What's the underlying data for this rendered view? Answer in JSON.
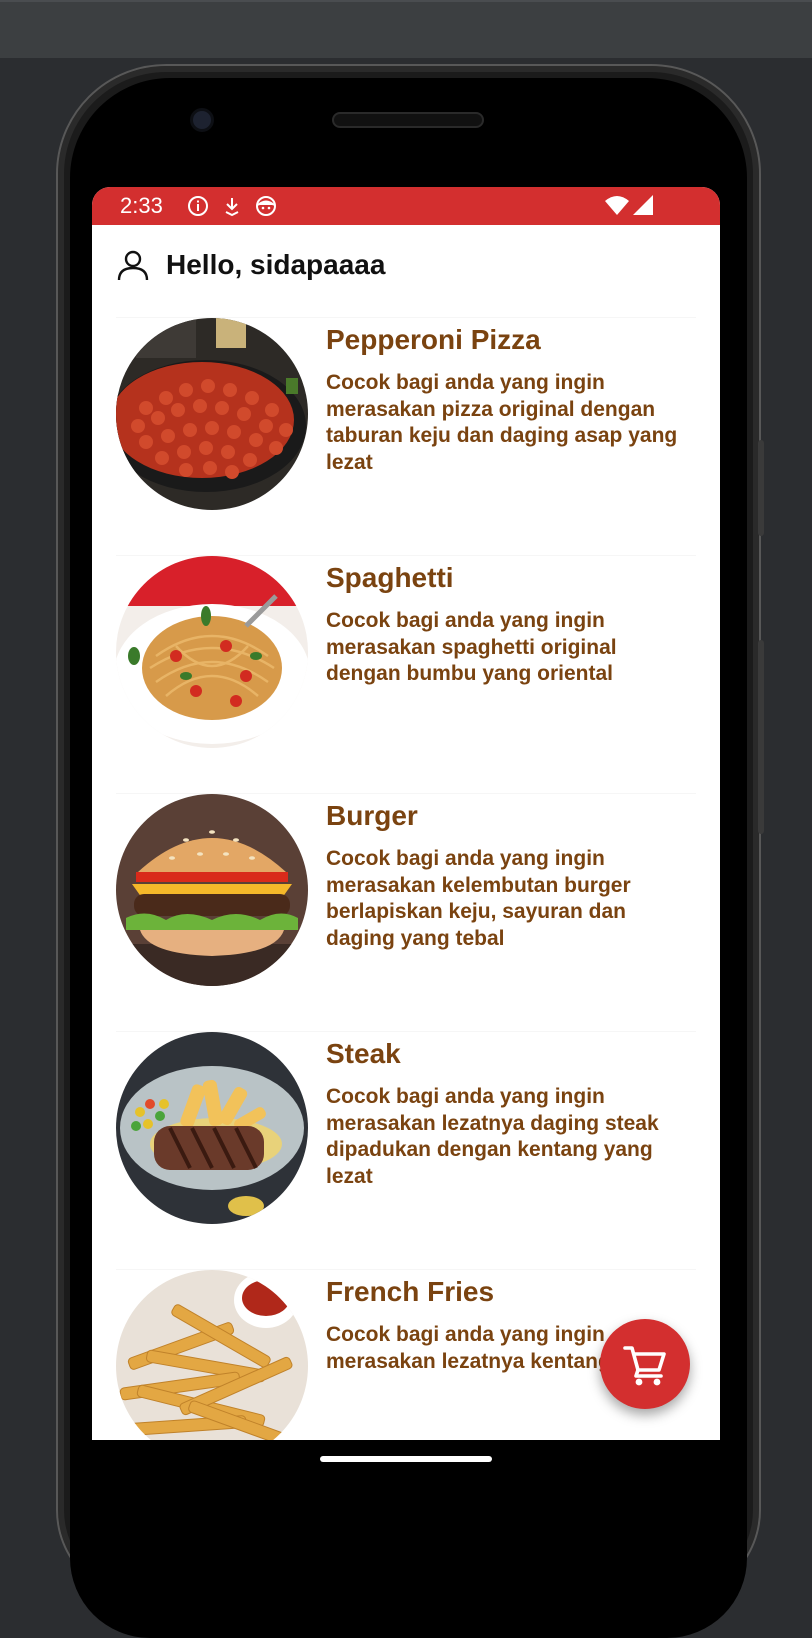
{
  "status_bar": {
    "time": "2:33",
    "icons": [
      "info-icon",
      "download-icon",
      "face-icon",
      "wifi-icon",
      "signal-icon"
    ]
  },
  "header": {
    "greeting": "Hello, sidapaaaa",
    "icon": "user-icon"
  },
  "menu_items": [
    {
      "title": "Pepperoni Pizza",
      "description": "Cocok bagi anda yang ingin merasakan pizza original dengan taburan keju dan daging asap yang lezat",
      "image": "pizza"
    },
    {
      "title": "Spaghetti",
      "description": "Cocok bagi anda yang ingin merasakan spaghetti original dengan bumbu yang oriental",
      "image": "spaghetti"
    },
    {
      "title": "Burger",
      "description": "Cocok bagi anda yang ingin merasakan kelembutan burger berlapiskan keju, sayuran dan daging yang tebal",
      "image": "burger"
    },
    {
      "title": "Steak",
      "description": "Cocok bagi anda yang ingin merasakan lezatnya daging steak dipadukan dengan kentang yang lezat",
      "image": "steak"
    },
    {
      "title": "French Fries",
      "description": "Cocok bagi anda yang ingin merasakan lezatnya kentang goreng",
      "image": "fries"
    }
  ],
  "fab": {
    "icon": "cart-icon"
  },
  "colors": {
    "accent": "#d32f2f",
    "text_brown": "#7a4310"
  }
}
